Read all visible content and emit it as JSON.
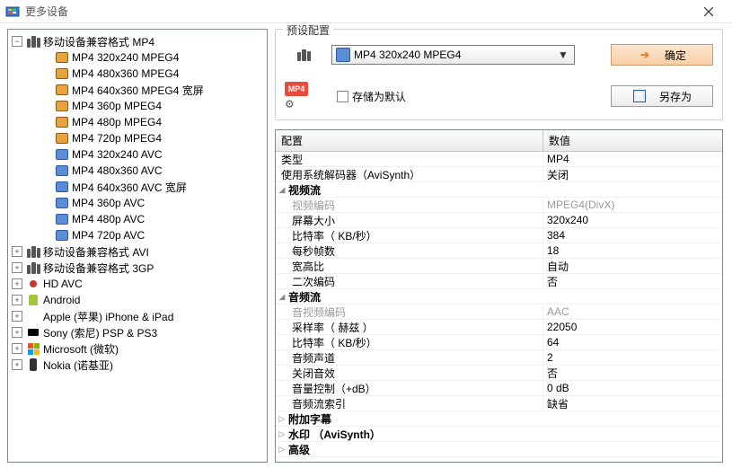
{
  "title": "更多设备",
  "tree": {
    "root": "移动设备兼容格式 MP4",
    "children": [
      "MP4 320x240 MPEG4",
      "MP4 480x360 MPEG4",
      "MP4 640x360 MPEG4 宽屏",
      "MP4 360p MPEG4",
      "MP4 480p MPEG4",
      "MP4 720p MPEG4",
      "MP4 320x240 AVC",
      "MP4 480x360 AVC",
      "MP4 640x360 AVC 宽屏",
      "MP4 360p AVC",
      "MP4 480p AVC",
      "MP4 720p AVC"
    ],
    "siblings": [
      "移动设备兼容格式 AVI",
      "移动设备兼容格式 3GP",
      "HD AVC",
      "Android",
      "Apple (苹果) iPhone & iPad",
      "Sony (索尼) PSP & PS3",
      "Microsoft (微软)",
      "Nokia (诺基亚)"
    ]
  },
  "preset": {
    "legend": "预设配置",
    "selected": "MP4 320x240 MPEG4",
    "save_default_label": "存储为默认",
    "mp4_badge": "MP4"
  },
  "buttons": {
    "ok": "确定",
    "save_as": "另存为"
  },
  "grid": {
    "col_name": "配置",
    "col_value": "数值",
    "rows": [
      {
        "k": "类型",
        "v": "MP4"
      },
      {
        "k": "使用系统解码器（AviSynth）",
        "v": "关闭"
      }
    ],
    "group_video": "视频流",
    "video_rows": [
      {
        "k": "视频编码",
        "v": "MPEG4(DivX)",
        "grey": true
      },
      {
        "k": "屏幕大小",
        "v": "320x240"
      },
      {
        "k": "比特率（ KB/秒）",
        "v": "384"
      },
      {
        "k": "每秒帧数",
        "v": "18"
      },
      {
        "k": "宽高比",
        "v": "自动"
      },
      {
        "k": "二次编码",
        "v": "否"
      }
    ],
    "group_audio": "音频流",
    "audio_rows": [
      {
        "k": "音视频编码",
        "v": "AAC",
        "grey": true
      },
      {
        "k": "采样率（ 赫兹 ）",
        "v": "22050"
      },
      {
        "k": "比特率（ KB/秒）",
        "v": "64"
      },
      {
        "k": "音频声道",
        "v": "2"
      },
      {
        "k": "关闭音效",
        "v": "否"
      },
      {
        "k": "音量控制（+dB）",
        "v": "0 dB"
      },
      {
        "k": "音频流索引",
        "v": "缺省"
      }
    ],
    "group_sub": "附加字幕",
    "group_wm": "水印 （AviSynth）",
    "group_adv": "高级"
  }
}
